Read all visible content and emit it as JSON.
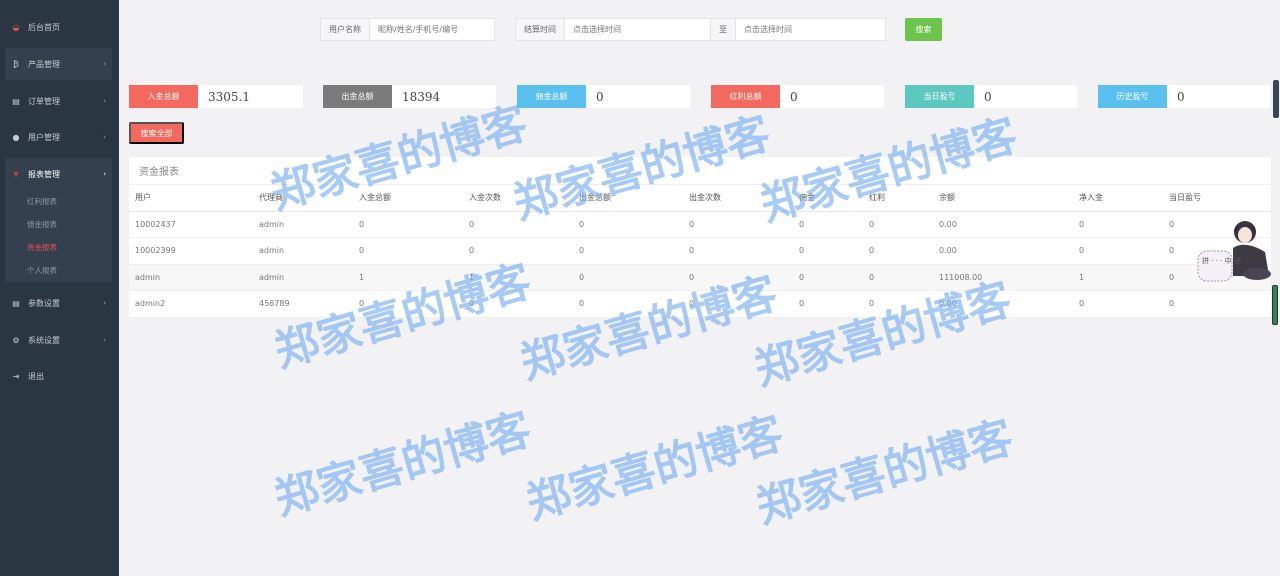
{
  "sidebar": {
    "home": "后台首页",
    "product": "产品管理",
    "order": "订单管理",
    "user": "用户管理",
    "report": "报表管理",
    "report_subs": [
      "红利报表",
      "佣金报表",
      "资金报表",
      "个人报表"
    ],
    "params": "参数设置",
    "system": "系统设置",
    "logout": "退出"
  },
  "search": {
    "username_label": "用户名称",
    "username_placeholder": "昵称/姓名/手机号/编号",
    "time_label": "结算时间",
    "start_placeholder": "点击选择时间",
    "to_label": "至",
    "end_placeholder": "点击选择时间",
    "button": "搜索"
  },
  "stats": [
    {
      "label": "入金总额",
      "value": "3305.1",
      "color": "#f3695f"
    },
    {
      "label": "出金总额",
      "value": "18394",
      "color": "#7b7b7b"
    },
    {
      "label": "佣金总额",
      "value": "0",
      "color": "#59c0f0"
    },
    {
      "label": "红利总额",
      "value": "0",
      "color": "#f3695f"
    },
    {
      "label": "当日盈亏",
      "value": "0",
      "color": "#5dc8c0"
    },
    {
      "label": "历史盈亏",
      "value": "0",
      "color": "#59c0f0"
    }
  ],
  "search_all": "搜索全部",
  "panel": {
    "title": "资金报表",
    "columns": [
      "用户",
      "代理商",
      "入金总额",
      "入金次数",
      "出金总额",
      "出金次数",
      "佣金",
      "红利",
      "余额",
      "净入金",
      "当日盈亏"
    ],
    "rows": [
      [
        "10002437",
        "admin",
        "0",
        "0",
        "0",
        "0",
        "0",
        "0",
        "0.00",
        "0",
        "0"
      ],
      [
        "10002399",
        "admin",
        "0",
        "0",
        "0",
        "0",
        "0",
        "0",
        "0.00",
        "0",
        "0"
      ],
      [
        "admin",
        "admin",
        "1",
        "1",
        "0",
        "0",
        "0",
        "0",
        "111008.00",
        "1",
        "0"
      ],
      [
        "admin2",
        "456789",
        "0",
        "0",
        "0",
        "0",
        "0",
        "0",
        "0.00",
        "0",
        "0"
      ]
    ]
  },
  "watermark": "郑家喜的博客",
  "mascot_text": "拼 · · · 中 键"
}
